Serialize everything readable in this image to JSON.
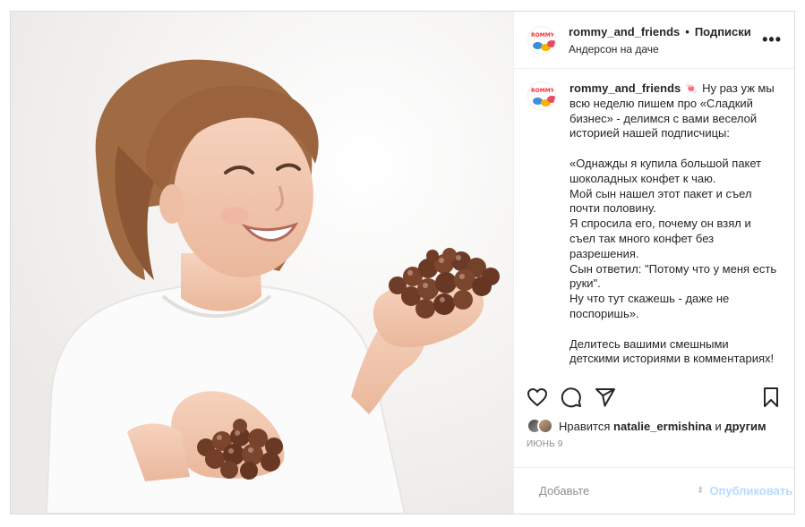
{
  "post": {
    "username": "rommy_and_friends",
    "follow_separator": "•",
    "follow_label": "Подписки",
    "location": "Андерсон на даче",
    "more_label": "•••"
  },
  "avatar": {
    "word": "ROMMY"
  },
  "caption": {
    "username": "rommy_and_friends",
    "emoji": "🍬",
    "text": "Ну раз уж мы всю неделю пишем про «Сладкий бизнес» - делимся с вами веселой историей нашей подписчицы:\n\n«Однажды я купила большой пакет шоколадных конфет к чаю.\nМой сын нашел этот пакет и съел почти половину.\nЯ спросила его, почему он взял и съел так много конфет без разрешения.\nСын ответил: \"Потому что у меня есть руки\".\nНу что тут скажешь - даже не поспоришь».\n\nДелитесь вашими смешными детскими историями в комментариях!"
  },
  "actions": [
    "heart-icon",
    "comment-icon",
    "share-icon",
    "bookmark-icon"
  ],
  "likes": {
    "prefix": "Нравится",
    "user": "natalie_ermishina",
    "connector": "и",
    "others": "другим"
  },
  "date": "Июнь 9",
  "comment": {
    "placeholder": "Добавьте",
    "publish_label": "Опубликовать"
  },
  "colors": {
    "accent": "#b3dbff",
    "border": "#dbdbdb",
    "muted": "#8e8e8e"
  }
}
